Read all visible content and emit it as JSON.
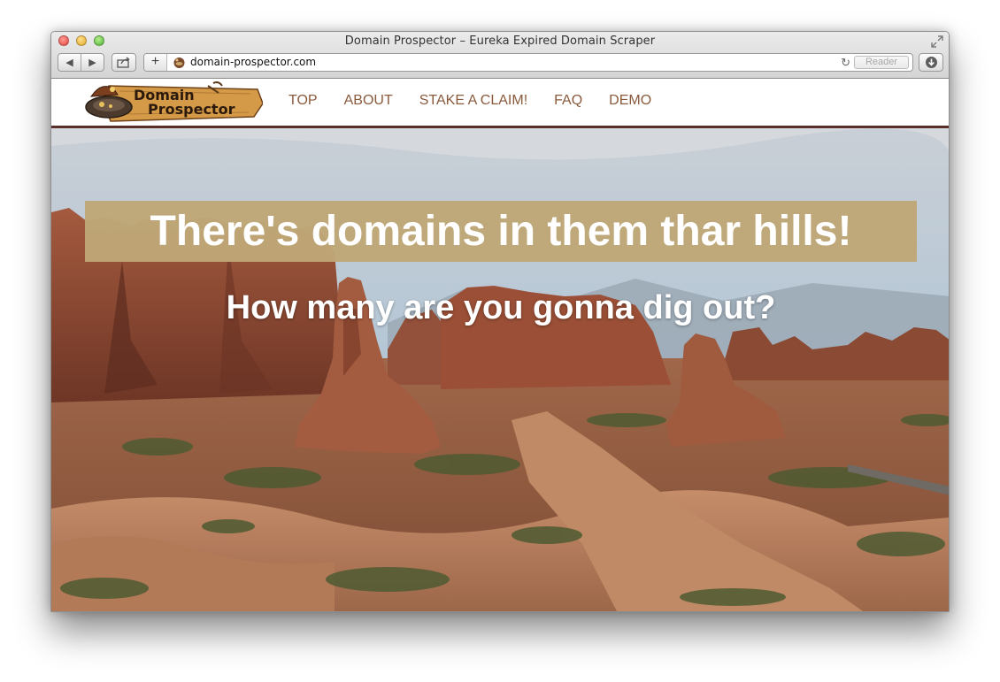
{
  "window": {
    "title": "Domain Prospector – Eureka Expired Domain Scraper",
    "url": "domain-prospector.com",
    "reader_label": "Reader"
  },
  "logo": {
    "line1": "Domain",
    "line2": "Prospector"
  },
  "nav": {
    "items": [
      {
        "label": "TOP"
      },
      {
        "label": "ABOUT"
      },
      {
        "label": "STAKE A CLAIM!"
      },
      {
        "label": "FAQ"
      },
      {
        "label": "DEMO"
      }
    ]
  },
  "hero": {
    "headline": "There's domains in them thar hills!",
    "subheadline": "How many are you gonna dig out?"
  },
  "colors": {
    "nav_text": "#8a5a3c",
    "banner_bg": "#bfa777",
    "nav_border": "#5a2f2a"
  }
}
